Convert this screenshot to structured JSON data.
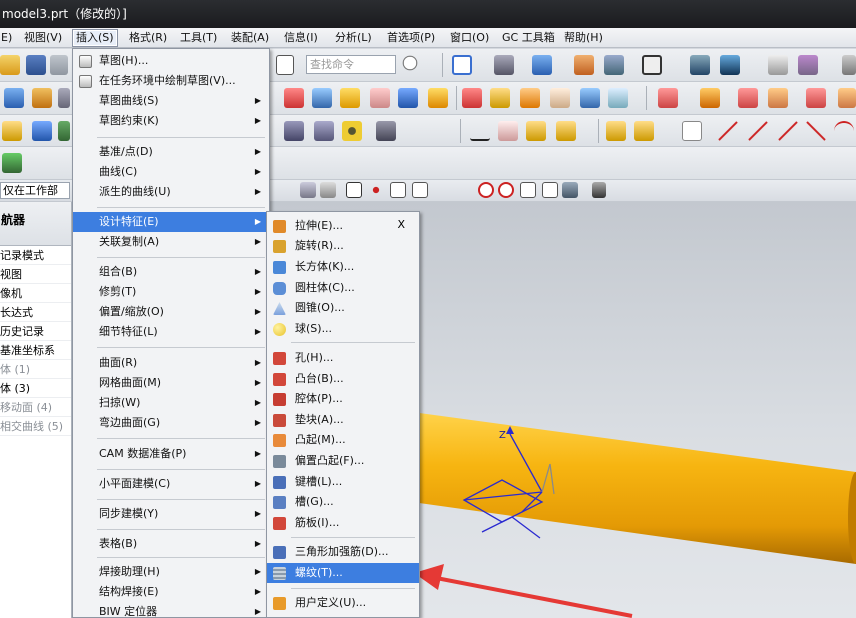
{
  "window": {
    "title": "model3.prt（修改的）]"
  },
  "menubar": {
    "items": [
      "E)",
      "视图(V)",
      "插入(S)",
      "格式(R)",
      "工具(T)",
      "装配(A)",
      "信息(I)",
      "分析(L)",
      "首选项(P)",
      "窗口(O)",
      "GC 工具箱",
      "帮助(H)"
    ],
    "active_index": 2
  },
  "toolbar": {
    "search_placeholder": "查找命令",
    "filter_combo": "仅在工作部"
  },
  "navigator": {
    "header": "航器",
    "rows": [
      {
        "label": "记录模式",
        "dim": false
      },
      {
        "label": "视图",
        "dim": false
      },
      {
        "label": "像机",
        "dim": false
      },
      {
        "label": "长达式",
        "dim": false
      },
      {
        "label": "历史记录",
        "dim": false
      },
      {
        "label": "基准坐标系",
        "dim": false
      },
      {
        "label": "体 (1)",
        "dim": true
      },
      {
        "label": "体 (3)",
        "dim": false
      },
      {
        "label": "移动面 (4)",
        "dim": true
      },
      {
        "label": "相交曲线 (5)",
        "dim": true
      }
    ]
  },
  "insert_menu": {
    "items": [
      {
        "label": "草图(H)...",
        "arrow": false,
        "icon": "sketch-icon"
      },
      {
        "label": "在任务环境中绘制草图(V)...",
        "arrow": false,
        "icon": "task-sketch-icon"
      },
      {
        "label": "草图曲线(S)",
        "arrow": true
      },
      {
        "label": "草图约束(K)",
        "arrow": true
      },
      {
        "label": "基准/点(D)",
        "arrow": true
      },
      {
        "label": "曲线(C)",
        "arrow": true
      },
      {
        "label": "派生的曲线(U)",
        "arrow": true
      },
      {
        "label": "设计特征(E)",
        "arrow": true,
        "highlight": true
      },
      {
        "label": "关联复制(A)",
        "arrow": true
      },
      {
        "label": "组合(B)",
        "arrow": true
      },
      {
        "label": "修剪(T)",
        "arrow": true
      },
      {
        "label": "偏置/缩放(O)",
        "arrow": true
      },
      {
        "label": "细节特征(L)",
        "arrow": true
      },
      {
        "label": "曲面(R)",
        "arrow": true
      },
      {
        "label": "网格曲面(M)",
        "arrow": true
      },
      {
        "label": "扫掠(W)",
        "arrow": true
      },
      {
        "label": "弯边曲面(G)",
        "arrow": true
      },
      {
        "label": "CAM 数据准备(P)",
        "arrow": true
      },
      {
        "label": "小平面建模(C)",
        "arrow": true
      },
      {
        "label": "同步建模(Y)",
        "arrow": true
      },
      {
        "label": "表格(B)",
        "arrow": true
      },
      {
        "label": "焊接助理(H)",
        "arrow": true
      },
      {
        "label": "结构焊接(E)",
        "arrow": true
      },
      {
        "label": "BIW 定位器",
        "arrow": true
      }
    ]
  },
  "feature_menu": {
    "shortcut": "X",
    "items": [
      {
        "label": "拉伸(E)...",
        "icon": "extrude-icon",
        "color": "#e08a2a"
      },
      {
        "label": "旋转(R)...",
        "icon": "revolve-icon",
        "color": "#d9a22e"
      },
      {
        "label": "长方体(K)...",
        "icon": "block-icon",
        "color": "#4a88d8"
      },
      {
        "label": "圆柱体(C)...",
        "icon": "cylinder-icon",
        "color": "#5b8ed6"
      },
      {
        "label": "圆锥(O)...",
        "icon": "cone-icon",
        "color": "#7aa0dc"
      },
      {
        "label": "球(S)...",
        "icon": "sphere-icon",
        "color": "#e8c22a"
      },
      {
        "label": "孔(H)...",
        "icon": "hole-icon",
        "color": "#d2473a"
      },
      {
        "label": "凸台(B)...",
        "icon": "boss-icon",
        "color": "#d2473a"
      },
      {
        "label": "腔体(P)...",
        "icon": "pocket-icon",
        "color": "#c63d32"
      },
      {
        "label": "垫块(A)...",
        "icon": "pad-icon",
        "color": "#c94a3a"
      },
      {
        "label": "凸起(M)...",
        "icon": "emboss-icon",
        "color": "#e88a3a"
      },
      {
        "label": "偏置凸起(F)...",
        "icon": "offset-emboss-icon",
        "color": "#7a8a9a"
      },
      {
        "label": "键槽(L)...",
        "icon": "slot-icon",
        "color": "#4a6fb8"
      },
      {
        "label": "槽(G)...",
        "icon": "groove-icon",
        "color": "#5a7fc2"
      },
      {
        "label": "筋板(I)...",
        "icon": "rib-icon",
        "color": "#d2473a"
      },
      {
        "label": "三角形加强筋(D)...",
        "icon": "dart-icon",
        "color": "#4a6fb8"
      },
      {
        "label": "螺纹(T)...",
        "icon": "thread-icon",
        "color": "#8a9aac",
        "highlight": true
      },
      {
        "label": "用户定义(U)...",
        "icon": "user-defined-icon",
        "color": "#e89a2a"
      }
    ]
  },
  "viewport": {
    "axis_label": "Z"
  }
}
